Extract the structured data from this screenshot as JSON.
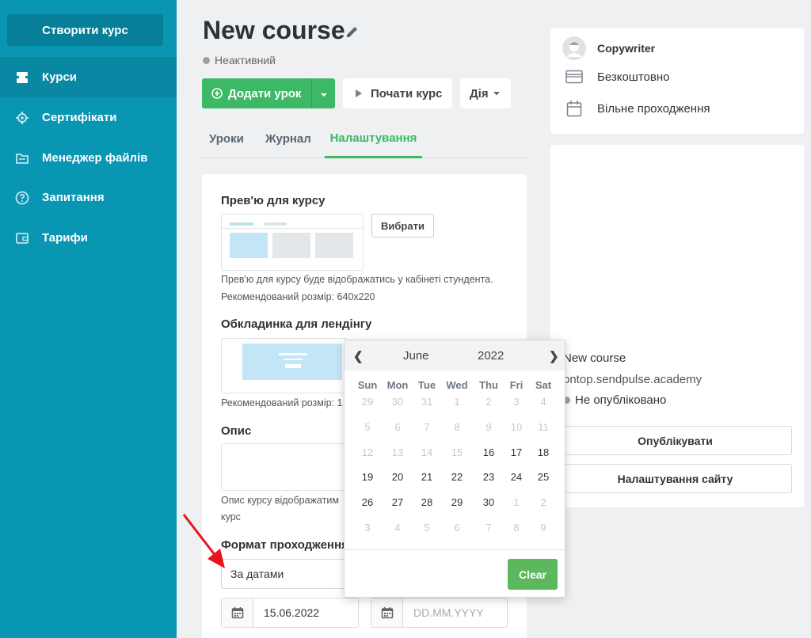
{
  "sidebar": {
    "create_label": "Створити курс",
    "items": [
      {
        "label": "Курси",
        "icon": "courses-icon"
      },
      {
        "label": "Сертифікати",
        "icon": "gear-icon"
      },
      {
        "label": "Менеджер файлів",
        "icon": "folder-icon"
      },
      {
        "label": "Запитання",
        "icon": "question-icon"
      },
      {
        "label": "Тарифи",
        "icon": "wallet-icon"
      }
    ]
  },
  "header": {
    "title": "New course",
    "status": "Неактивний",
    "add_lesson_label": "Додати урок",
    "start_course_label": "Почати курс",
    "action_label": "Дія"
  },
  "tabs": [
    {
      "label": "Уроки"
    },
    {
      "label": "Журнал"
    },
    {
      "label": "Налаштування"
    }
  ],
  "settings": {
    "preview_title": "Прев'ю для курсу",
    "choose_label": "Вибрати",
    "preview_hint_1": "Прев'ю для курсу буде відображатись у кабінеті стундента.",
    "preview_hint_2": "Рекомендований розмір: 640x220",
    "cover_title": "Обкладинка для лендінгу",
    "cover_hint": "Рекомендований розмір: 1",
    "description_title": "Опис",
    "description_hint_1": "Опис курсу відображатим",
    "description_hint_2": "курс",
    "format_title": "Формат проходження",
    "format_value": "За датами",
    "start_date": "15.06.2022",
    "end_date_placeholder": "DD.MM.YYYY"
  },
  "right_panel": {
    "author": "Copywriter",
    "price": "Безкоштовно",
    "mode": "Вільне проходження",
    "site_title": "New course",
    "site_url": "ontop.sendpulse.academy",
    "site_status": "Не опубліковано",
    "publish_label": "Опублікувати",
    "site_settings_label": "Налаштування сайту"
  },
  "calendar": {
    "prev": "❮",
    "next": "❯",
    "month": "June",
    "year": "2022",
    "weekdays": [
      "Sun",
      "Mon",
      "Tue",
      "Wed",
      "Thu",
      "Fri",
      "Sat"
    ],
    "weeks": [
      [
        "29",
        "30",
        "31",
        "1",
        "2",
        "3",
        "4"
      ],
      [
        "5",
        "6",
        "7",
        "8",
        "9",
        "10",
        "11"
      ],
      [
        "12",
        "13",
        "14",
        "15",
        "16",
        "17",
        "18"
      ],
      [
        "19",
        "20",
        "21",
        "22",
        "23",
        "24",
        "25"
      ],
      [
        "26",
        "27",
        "28",
        "29",
        "30",
        "1",
        "2"
      ],
      [
        "3",
        "4",
        "5",
        "6",
        "7",
        "8",
        "9"
      ]
    ],
    "clear_label": "Clear"
  },
  "colors": {
    "sidebar": "#0896b3",
    "primary_green": "#3cb867",
    "clear_green": "#5cb85c",
    "annotation_arrow": "#e8141b"
  }
}
